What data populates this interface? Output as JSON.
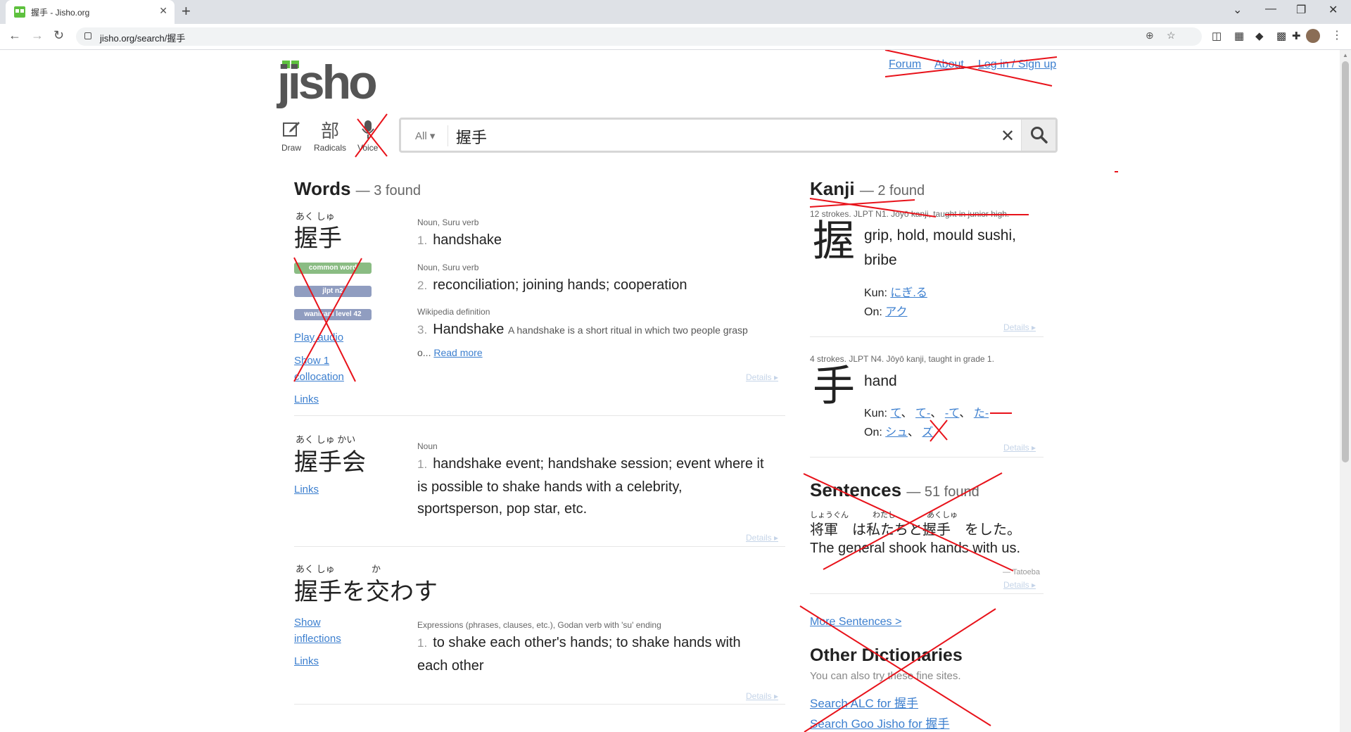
{
  "browser": {
    "tab_title": "握手 - Jisho.org",
    "url": "jisho.org/search/握手"
  },
  "header": {
    "logo": "jisho",
    "nav": [
      "Forum",
      "About",
      "Log in / Sign up"
    ]
  },
  "tools": [
    {
      "label": "Draw",
      "icon": "pencil-icon"
    },
    {
      "label": "Radicals",
      "glyph": "部",
      "icon": "radicals-icon"
    },
    {
      "label": "Voice",
      "icon": "microphone-icon"
    }
  ],
  "search": {
    "filter": "All",
    "query": "握手"
  },
  "words": {
    "title": "Words",
    "count": "— 3 found",
    "entries": [
      {
        "furigana": "あく しゅ",
        "word": "握手",
        "tags": [
          "common word",
          "jlpt n2",
          "wanikani level 42"
        ],
        "links": [
          "Play audio",
          "Show 1",
          "collocation",
          "Links"
        ],
        "senses": [
          {
            "pos": "Noun, Suru verb",
            "num": "1.",
            "text": "handshake"
          },
          {
            "pos": "Noun, Suru verb",
            "num": "2.",
            "text": "reconciliation; joining hands; cooperation"
          },
          {
            "pos": "Wikipedia definition",
            "num": "3.",
            "text": "Handshake",
            "extra": "A handshake is a short ritual in which two people grasp",
            "extra2": "o...",
            "more": "Read more"
          }
        ],
        "details": "Details ▸"
      },
      {
        "furigana": "あく しゅ かい",
        "word": "握手会",
        "links": [
          "Links"
        ],
        "senses": [
          {
            "pos": "Noun",
            "num": "1.",
            "text": "handshake event; handshake session; event where it",
            "line2": "is possible to shake hands with a celebrity,",
            "line3": "sportsperson, pop star, etc."
          }
        ],
        "details": "Details ▸"
      },
      {
        "furigana1": "あく しゅ",
        "furigana2": "か",
        "word": "握手を交わす",
        "links": [
          "Show",
          "inflections",
          "Links"
        ],
        "senses": [
          {
            "pos": "Expressions (phrases, clauses, etc.), Godan verb with 'su' ending",
            "num": "1.",
            "text": "to shake each other's hands; to shake hands with",
            "line2": "each other"
          }
        ],
        "details": "Details ▸"
      }
    ]
  },
  "kanji": {
    "title": "Kanji",
    "count": "— 2 found",
    "entries": [
      {
        "meta": "12 strokes. JLPT N1. Jōyō kanji, taught in junior high.",
        "char": "握",
        "meaning1": "grip, hold, mould sushi,",
        "meaning2": "bribe",
        "kun_label": "Kun:",
        "kun": [
          "にぎ.る"
        ],
        "on_label": "On:",
        "on": [
          "アク"
        ],
        "details": "Details ▸"
      },
      {
        "meta": "4 strokes. JLPT N4. Jōyō kanji, taught in grade 1.",
        "char": "手",
        "meaning1": "hand",
        "kun_label": "Kun:",
        "kun": [
          "て",
          "て-",
          "-て",
          "た-"
        ],
        "on_label": "On:",
        "on": [
          "シュ",
          "ズ"
        ],
        "details": "Details ▸"
      }
    ]
  },
  "sentences": {
    "title": "Sentences",
    "count": "— 51 found",
    "furigana": [
      "しょうぐん",
      "わたし",
      "あくしゅ"
    ],
    "ja": "将軍　は私たちと握手　をした。",
    "en": "The general shook hands with us.",
    "source": "— Tatoeba",
    "details": "Details ▸",
    "more": "More Sentences >"
  },
  "other_dicts": {
    "title": "Other Dictionaries",
    "subtitle": "You can also try these fine sites.",
    "links": [
      "Search ALC for 握手",
      "Search Goo Jisho for 握手"
    ]
  },
  "colors": {
    "link": "#3c7fcf",
    "tag_common": "#8abc83",
    "tag_jlpt": "#909dc0",
    "brand_green": "#5ec13e",
    "annotation_red": "#e8121a"
  }
}
